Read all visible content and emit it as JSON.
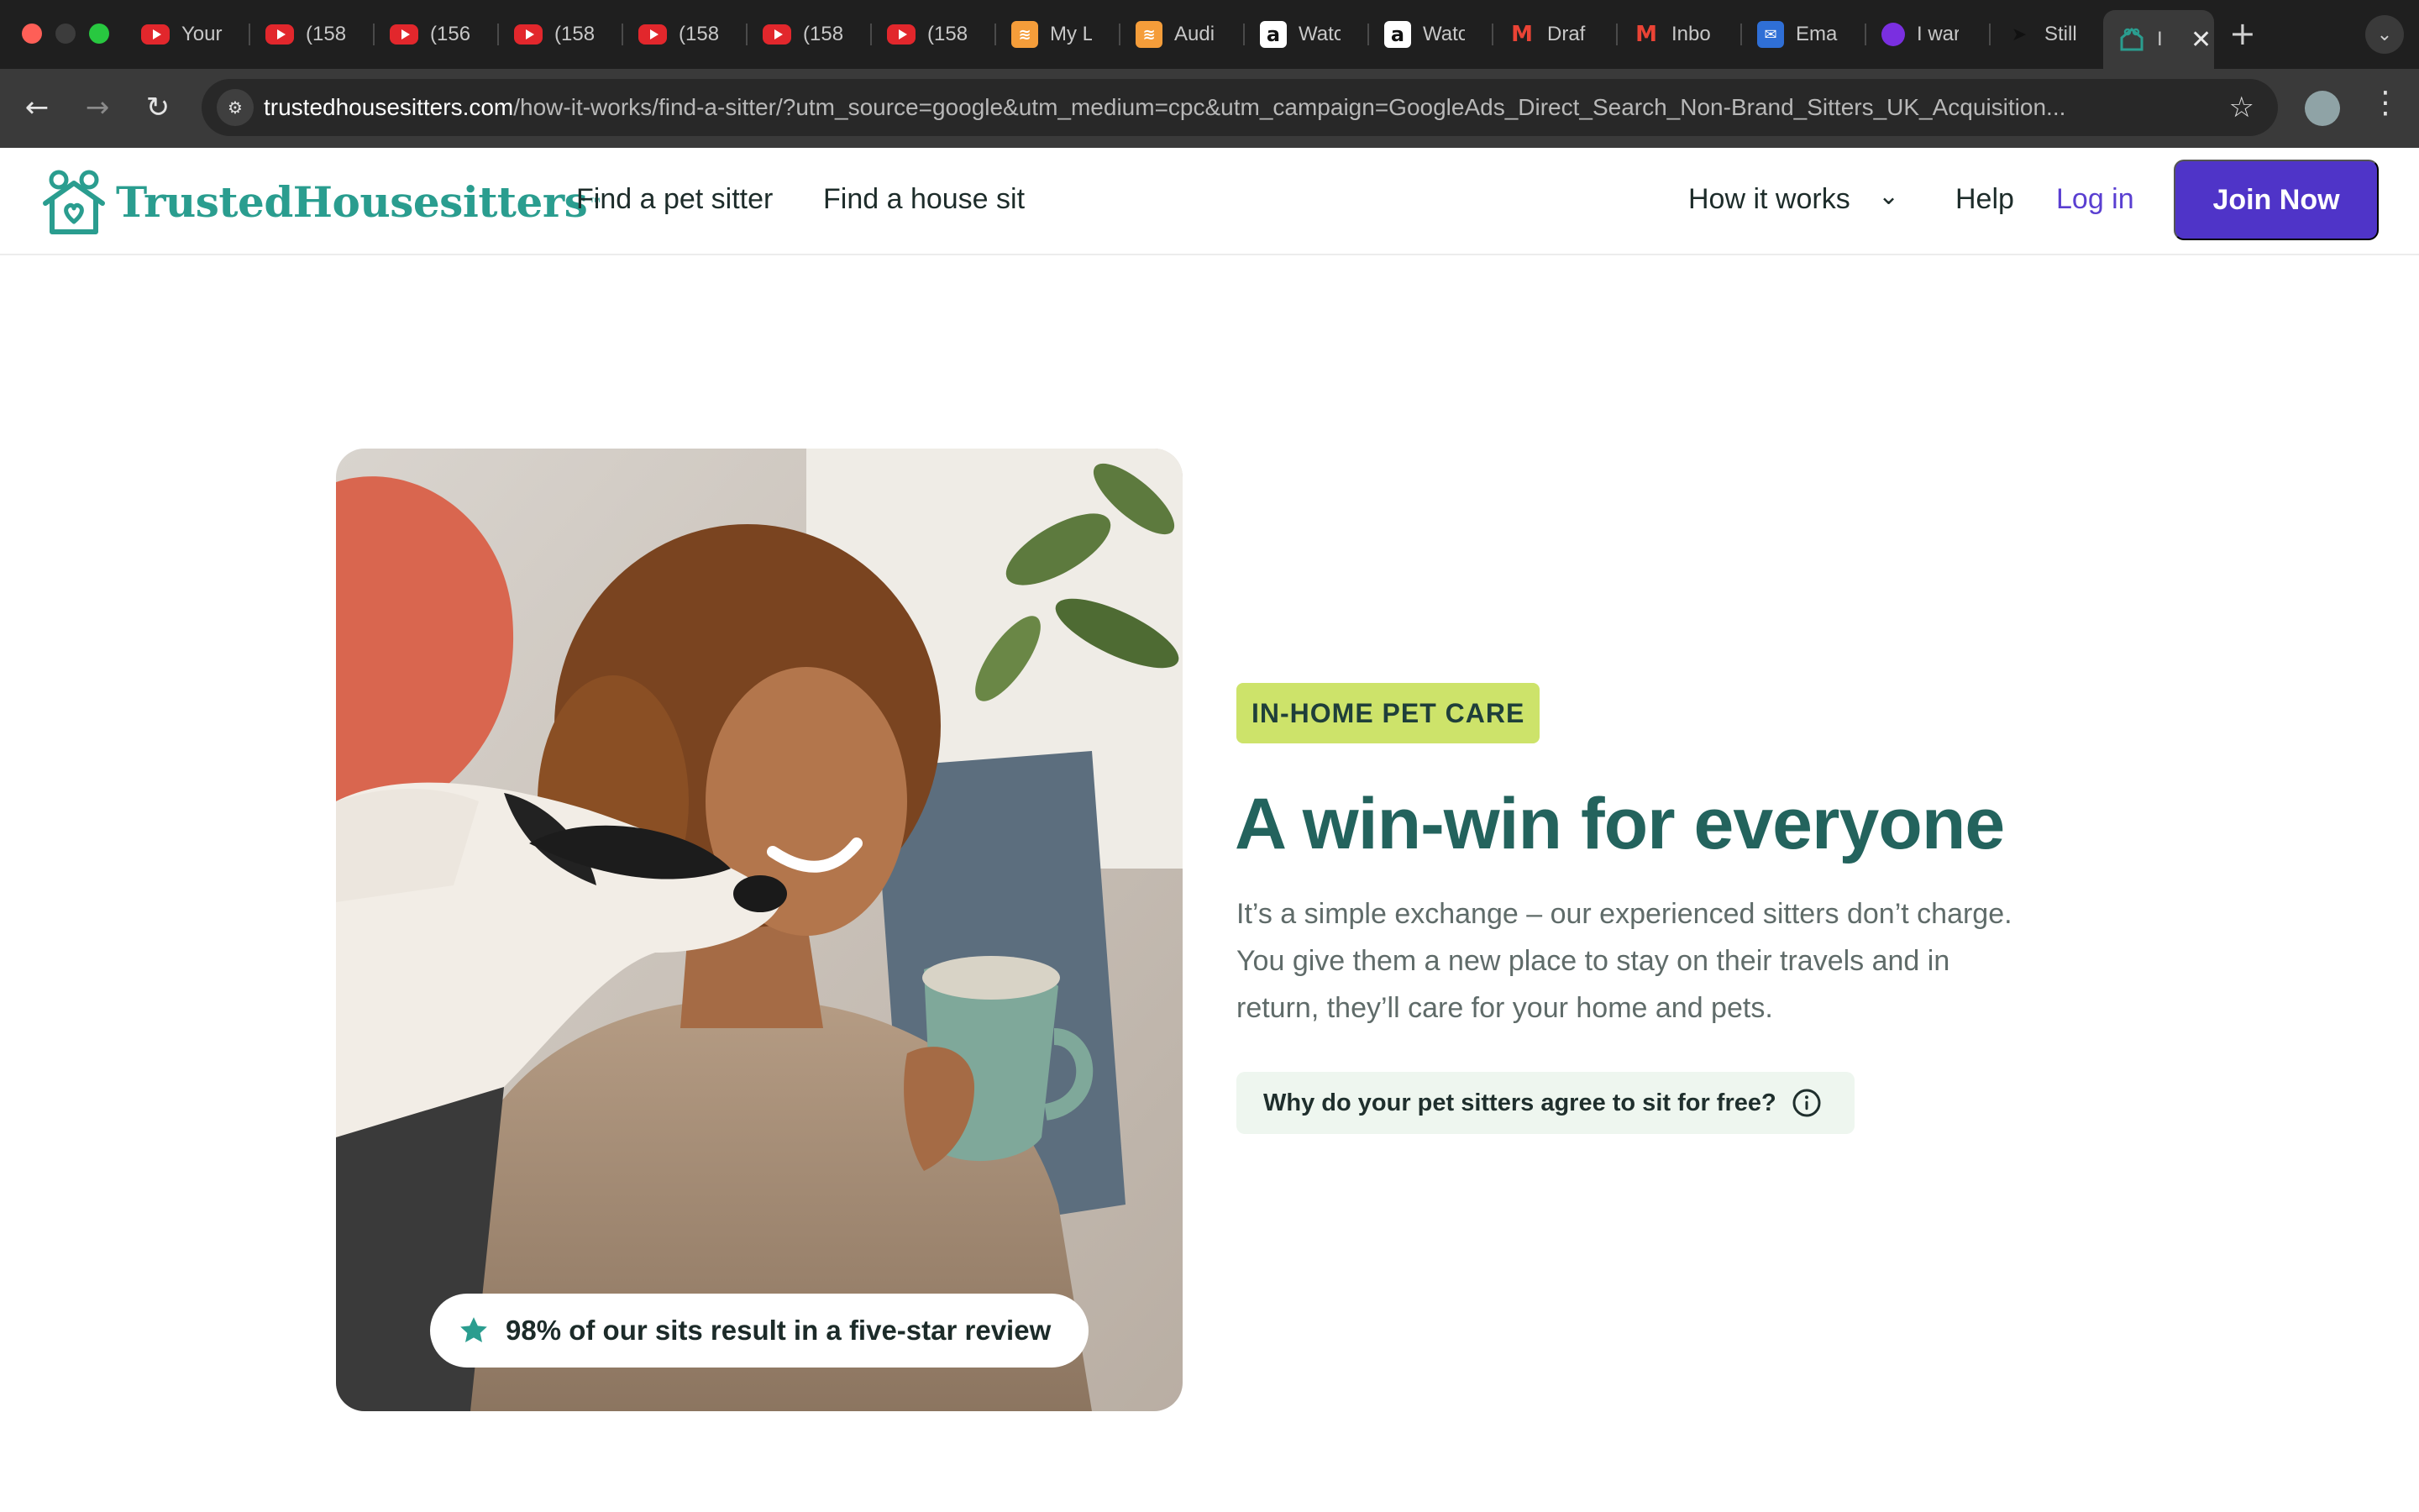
{
  "browser": {
    "tabs": [
      {
        "icon": "youtube-icon",
        "title": "Your"
      },
      {
        "icon": "youtube-icon",
        "title": "(158"
      },
      {
        "icon": "youtube-icon",
        "title": "(156"
      },
      {
        "icon": "youtube-icon",
        "title": "(158"
      },
      {
        "icon": "youtube-icon",
        "title": "(158"
      },
      {
        "icon": "youtube-icon",
        "title": "(158"
      },
      {
        "icon": "youtube-icon",
        "title": "(158"
      },
      {
        "icon": "audible-icon",
        "title": "My L"
      },
      {
        "icon": "audible-icon",
        "title": "Audi"
      },
      {
        "icon": "amazon-icon",
        "title": "Watc"
      },
      {
        "icon": "amazon-icon",
        "title": "Watc"
      },
      {
        "icon": "gmail-icon",
        "title": "Draf"
      },
      {
        "icon": "gmail-icon",
        "title": "Inbo"
      },
      {
        "icon": "outlook-icon",
        "title": "Emai"
      },
      {
        "icon": "circle-icon",
        "title": "I war"
      },
      {
        "icon": "bird-icon",
        "title": "Still"
      }
    ],
    "active_tab": {
      "icon": "trustedhousesitters-icon",
      "title": "I"
    },
    "url_host": "trustedhousesitters.com",
    "url_path": "/how-it-works/find-a-sitter/?utm_source=google&utm_medium=cpc&utm_campaign=GoogleAds_Direct_Search_Non-Brand_Sitters_UK_Acquisition..."
  },
  "header": {
    "logo_text": "TrustedHousesitters",
    "logo_tm": "™",
    "nav": {
      "find_pet_sitter": "Find a pet sitter",
      "find_house_sit": "Find a house sit",
      "how_it_works": "How it works",
      "help": "Help",
      "login": "Log in",
      "join": "Join Now"
    }
  },
  "hero": {
    "badge": "IN-HOME PET CARE",
    "headline": "A win-win for everyone",
    "body_lines": [
      "It’s a simple exchange – our experienced sitters don’t charge.",
      "You give them a new place to stay on their travels and in",
      "return, they’ll care for your home and pets."
    ],
    "faq_question": "Why do your pet sitters agree to sit for free?",
    "review_text": "98% of our sits result in a five-star review"
  },
  "colors": {
    "brand_teal": "#2a9d8f",
    "headline_green": "#23635d",
    "join_purple": "#4f34c8",
    "badge_lime": "#cde36a",
    "chip_bg": "#eef6ef"
  }
}
